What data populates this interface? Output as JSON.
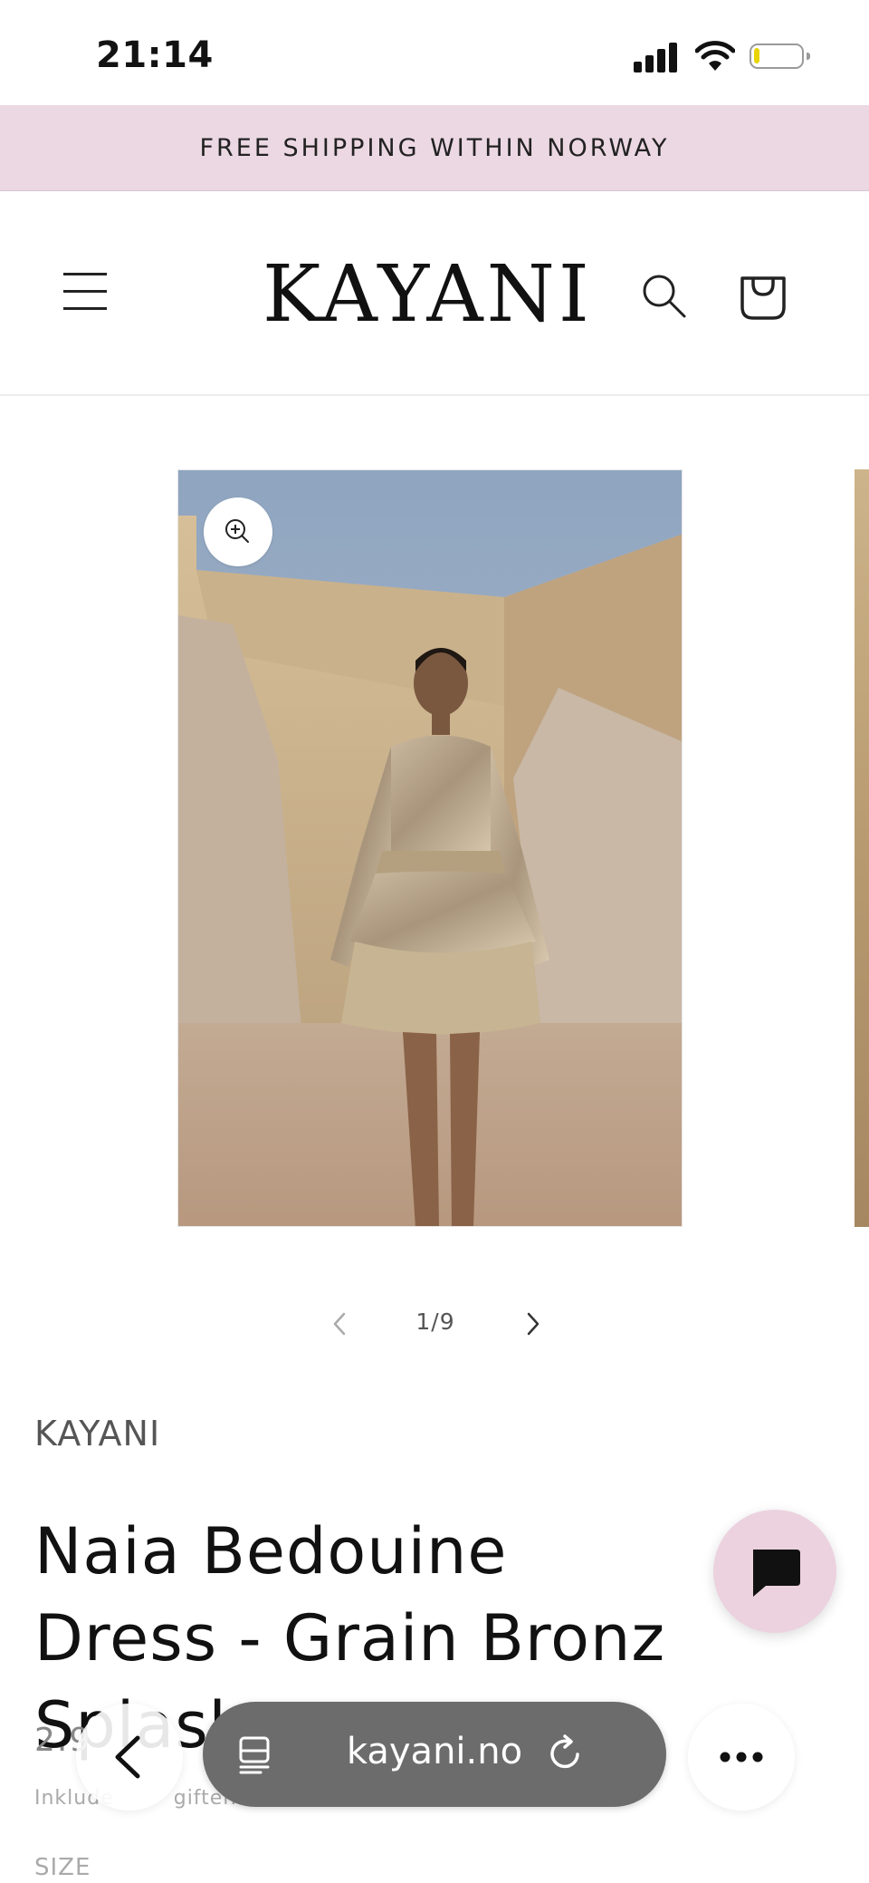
{
  "status_bar": {
    "time": "21:14",
    "icons": [
      "signal-icon",
      "wifi-icon",
      "battery-icon"
    ]
  },
  "announcement": {
    "text": "FREE SHIPPING WITHIN NORWAY",
    "background": "#ecd8e2"
  },
  "header": {
    "logo": "KAYANI",
    "icons": [
      "menu-icon",
      "search-icon",
      "cart-icon"
    ]
  },
  "gallery": {
    "counter": "1/9",
    "current": 1,
    "total": 9,
    "icons": [
      "zoom-icon",
      "chevron-left-icon",
      "chevron-right-icon"
    ]
  },
  "product": {
    "vendor": "KAYANI",
    "title": "Naia Bedouine Dress - Grain Bronz Splash",
    "price_visible": "2.9",
    "tax_visible": "Inklude",
    "tax_visible_2": "gifter.",
    "size_label": "SIZE"
  },
  "chat": {
    "icon": "chat-icon",
    "background": "#ecd2df"
  },
  "browser": {
    "url": "kayani.no",
    "icons": [
      "back-icon",
      "tabs-icon",
      "reload-icon",
      "more-icon"
    ]
  }
}
